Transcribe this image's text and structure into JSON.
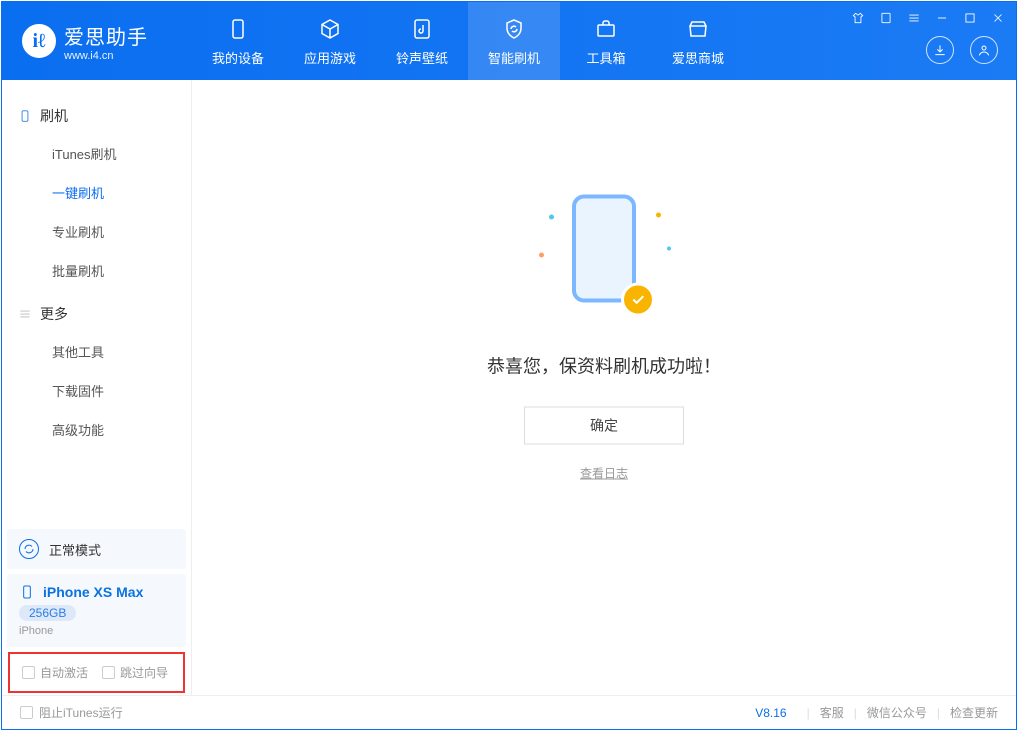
{
  "brand": {
    "name": "爱思助手",
    "url": "www.i4.cn"
  },
  "tabs": {
    "device": "我的设备",
    "apps": "应用游戏",
    "ring": "铃声壁纸",
    "flash": "智能刷机",
    "tools": "工具箱",
    "store": "爱思商城"
  },
  "sidebar": {
    "flash_group": "刷机",
    "items": {
      "itunes": "iTunes刷机",
      "oneclick": "一键刷机",
      "pro": "专业刷机",
      "batch": "批量刷机"
    },
    "more_group": "更多",
    "more": {
      "other": "其他工具",
      "fw": "下载固件",
      "adv": "高级功能"
    }
  },
  "device": {
    "mode": "正常模式",
    "name": "iPhone XS Max",
    "storage": "256GB",
    "type": "iPhone"
  },
  "options": {
    "auto_activate": "自动激活",
    "skip_guide": "跳过向导"
  },
  "result": {
    "message": "恭喜您，保资料刷机成功啦！",
    "ok": "确定",
    "log": "查看日志"
  },
  "footer": {
    "block_itunes": "阻止iTunes运行",
    "version": "V8.16",
    "service": "客服",
    "wechat": "微信公众号",
    "update": "检查更新"
  }
}
